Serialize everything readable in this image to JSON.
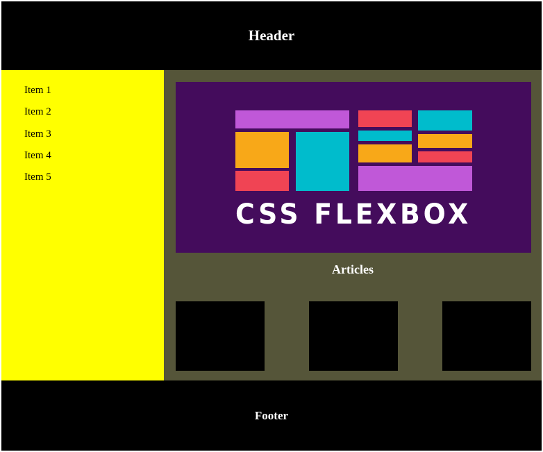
{
  "header": {
    "title": "Header"
  },
  "sidebar": {
    "items": [
      {
        "label": "Item 1"
      },
      {
        "label": "Item 2"
      },
      {
        "label": "Item 3"
      },
      {
        "label": "Item 4"
      },
      {
        "label": "Item 5"
      }
    ]
  },
  "main": {
    "hero": {
      "logo_text": "CSS FLEXBOX"
    },
    "articles_title": "Articles",
    "cards": [
      {},
      {},
      {}
    ]
  },
  "footer": {
    "title": "Footer"
  },
  "colors": {
    "header_bg": "#000000",
    "sidebar_bg": "#ffff00",
    "main_bg": "#555539",
    "hero_bg": "#440c5c",
    "block_purple": "#c058d8",
    "block_red": "#f04454",
    "block_orange": "#f8a818",
    "block_cyan": "#00bccc"
  }
}
